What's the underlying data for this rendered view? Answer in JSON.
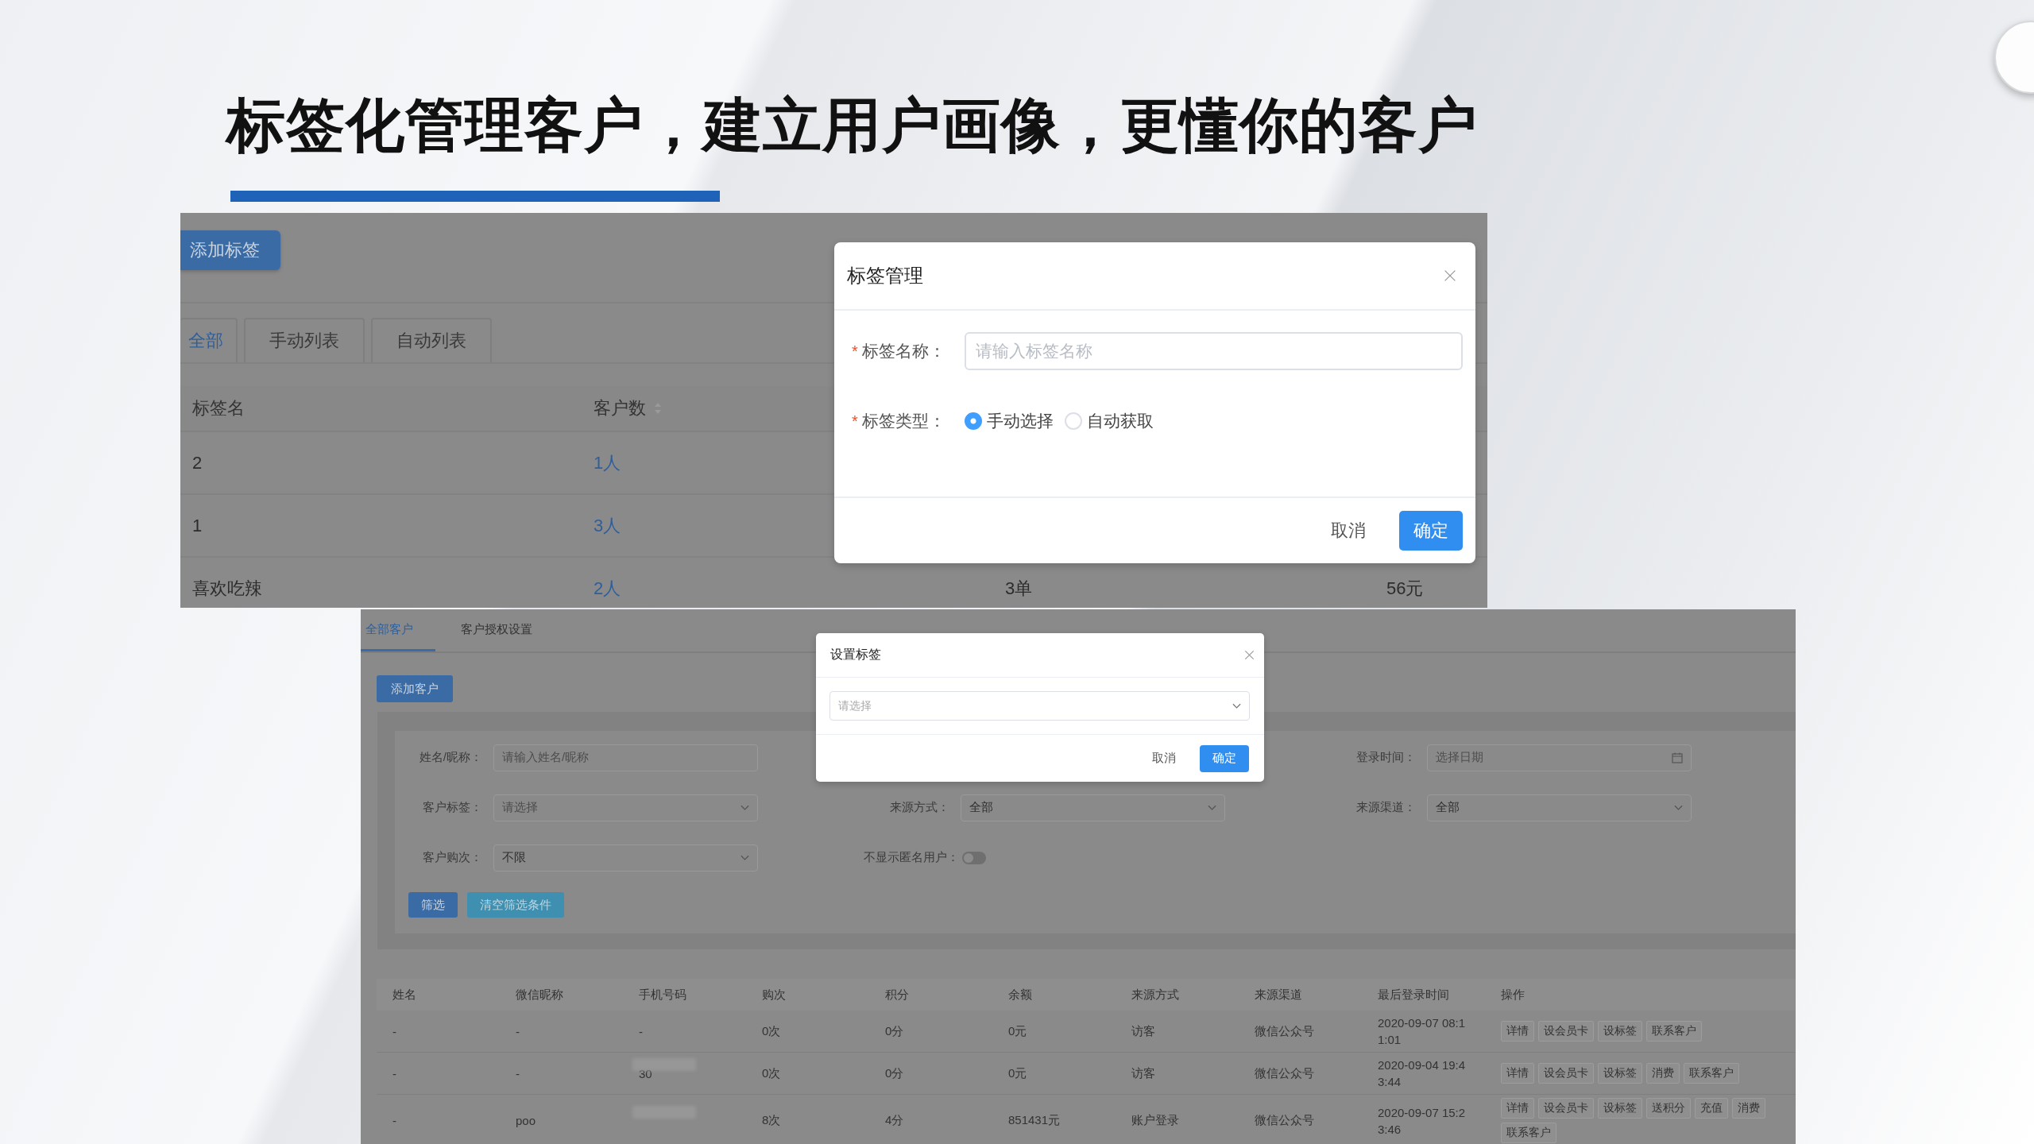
{
  "slide": {
    "title": "标签化管理客户，建立用户画像，更懂你的客户"
  },
  "tag_page": {
    "add_button": "添加标签",
    "tabs": [
      {
        "label": "全部",
        "selected": true
      },
      {
        "label": "手动列表",
        "selected": false
      },
      {
        "label": "自动列表",
        "selected": false
      }
    ],
    "table": {
      "columns": [
        {
          "label": "标签名",
          "sortable": false
        },
        {
          "label": "客户数",
          "sortable": true
        }
      ],
      "rows": [
        {
          "cells": [
            "2",
            "1人"
          ]
        },
        {
          "cells": [
            "1",
            "3人"
          ]
        },
        {
          "cells": [
            "喜欢吃辣",
            "2人",
            "3单",
            "56元"
          ]
        }
      ]
    },
    "dialog": {
      "title": "标签管理",
      "fields": [
        {
          "kind": "input",
          "mark": "*",
          "label": "标签名称：",
          "placeholder": "请输入标签名称"
        },
        {
          "kind": "radio",
          "mark": "*",
          "label": "标签类型：",
          "options": [
            {
              "label": "手动选择",
              "selected": true
            },
            {
              "label": "自动获取",
              "selected": false
            }
          ]
        }
      ],
      "buttons": [
        {
          "label": "取消",
          "kind": "text"
        },
        {
          "label": "确定",
          "kind": "primary"
        }
      ]
    }
  },
  "customer_page": {
    "tabs": [
      {
        "label": "全部客户",
        "selected": true
      },
      {
        "label": "客户授权设置",
        "selected": false
      }
    ],
    "add_button": "添加客户",
    "filter_rows": [
      [
        {
          "kind": "input",
          "label": "姓名/昵称：",
          "placeholder": "请输入姓名/昵称"
        },
        null,
        {
          "kind": "date",
          "label": "登录时间：",
          "placeholder": "选择日期"
        }
      ],
      [
        {
          "kind": "select",
          "label": "客户标签：",
          "placeholder": "请选择"
        },
        {
          "kind": "select",
          "label": "来源方式：",
          "value": "全部"
        },
        {
          "kind": "select",
          "label": "来源渠道：",
          "value": "全部"
        }
      ],
      [
        {
          "kind": "select",
          "label": "客户购次：",
          "value": "不限"
        },
        {
          "kind": "switch",
          "label": "不显示匿名用户：",
          "on": false
        }
      ]
    ],
    "filter_buttons": [
      {
        "label": "筛选",
        "kind": "primary"
      },
      {
        "label": "清空筛选条件",
        "kind": "secondary"
      }
    ],
    "table": {
      "columns": [
        "姓名",
        "微信昵称",
        "手机号码",
        "购次",
        "积分",
        "余额",
        "来源方式",
        "来源渠道",
        "最后登录时间",
        "操作"
      ],
      "rows": [
        {
          "cells": [
            "-",
            "-",
            "-",
            "0次",
            "0分",
            "0元",
            "访客",
            "微信公众号",
            "2020-09-07 08:11:01"
          ],
          "phone_masked": false,
          "actions": [
            "详情",
            "设会员卡",
            "设标签",
            "联系客户"
          ]
        },
        {
          "cells": [
            "-",
            "-",
            "30",
            "0次",
            "0分",
            "0元",
            "访客",
            "微信公众号",
            "2020-09-04 19:43:44"
          ],
          "phone_masked": true,
          "actions": [
            "详情",
            "设会员卡",
            "设标签",
            "消费",
            "联系客户"
          ]
        },
        {
          "cells": [
            "-",
            "poo",
            null,
            "8次",
            "4分",
            "851431元",
            "账户登录",
            "微信公众号",
            "2020-09-07 15:23:46"
          ],
          "phone_masked": true,
          "actions": [
            "详情",
            "设会员卡",
            "设标签",
            "送积分",
            "充值",
            "消费",
            "联系客户"
          ]
        }
      ]
    },
    "dialog": {
      "title": "设置标签",
      "placeholder": "请选择",
      "buttons": [
        {
          "label": "取消",
          "kind": "text"
        },
        {
          "label": "确定",
          "kind": "primary"
        }
      ]
    }
  }
}
